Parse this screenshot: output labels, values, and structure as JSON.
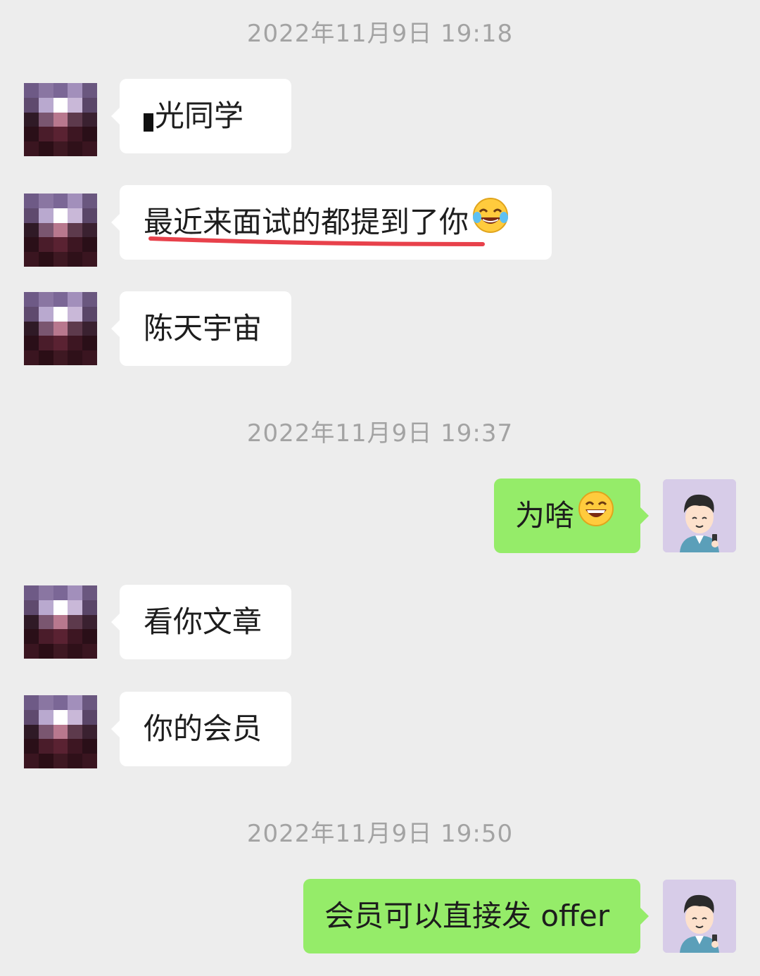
{
  "timestamps": [
    "2022年11月9日 19:18",
    "2022年11月9日 19:37",
    "2022年11月9日 19:50"
  ],
  "messages": [
    {
      "text": "光同学",
      "side": "in"
    },
    {
      "text": "最近来面试的都提到了你",
      "side": "in",
      "emoji": "laughing-tears-emoji",
      "underlined": true
    },
    {
      "text": "陈天宇宙",
      "side": "in"
    },
    {
      "text": "为啥",
      "side": "out",
      "emoji": "grinning-emoji"
    },
    {
      "text": "看你文章",
      "side": "in"
    },
    {
      "text": "你的会员",
      "side": "in"
    },
    {
      "text": "会员可以直接发 offer",
      "side": "out"
    }
  ],
  "colors": {
    "background": "#ededed",
    "incoming_bubble": "#ffffff",
    "outgoing_bubble": "#95ec69",
    "timestamp": "#a3a3a3",
    "underline": "#e8414b"
  }
}
